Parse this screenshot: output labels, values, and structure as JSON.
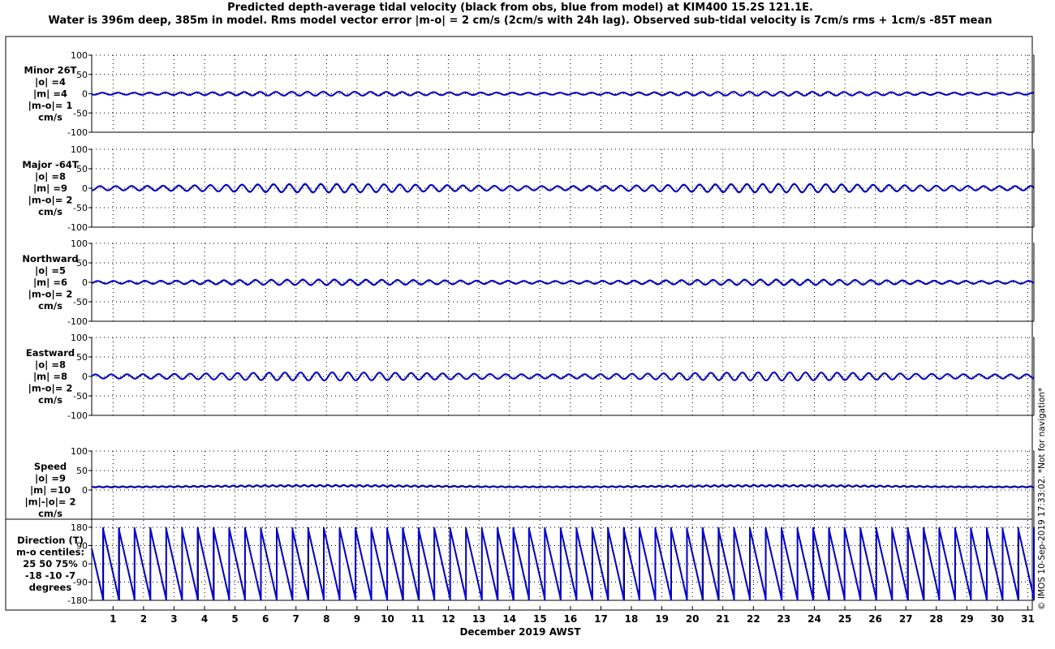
{
  "title_line1": "Predicted depth-average tidal velocity (black from obs, blue from model) at KIM400 15.2S 121.1E.",
  "title_line2": "Water is 396m deep, 385m in model. Rms model vector error |m-o| = 2 cm/s (2cm/s with 24h lag). Observed sub-tidal velocity is 7cm/s rms + 1cm/s -85T mean",
  "side_note": "© IMOS 10-Sep-2019 17:33:02. *Not for navigation*",
  "xlabel": "December 2019 AWST",
  "colors": {
    "obs": "#000000",
    "model": "#0000ff",
    "grid": "#000000"
  },
  "chart_data": {
    "type": "line",
    "x_ticks": [
      "1",
      "2",
      "3",
      "4",
      "5",
      "6",
      "7",
      "8",
      "9",
      "10",
      "11",
      "12",
      "13",
      "14",
      "15",
      "16",
      "17",
      "18",
      "19",
      "20",
      "21",
      "22",
      "23",
      "24",
      "25",
      "26",
      "27",
      "28",
      "29",
      "30",
      "31"
    ],
    "xlim": [
      0.3,
      31.2
    ],
    "grid": true,
    "panels": [
      {
        "key": "minor",
        "label_lines": [
          "Minor 26T",
          "|o| =4",
          "|m| =4",
          "|m-o|= 1",
          "cm/s"
        ],
        "ylim": [
          -100,
          100
        ],
        "yticks": [
          "100",
          "50",
          "0",
          "-50",
          "-100"
        ],
        "series": [
          {
            "name": "obs",
            "amplitude": 4,
            "mean": 0
          },
          {
            "name": "model",
            "amplitude": 4,
            "mean": 0
          }
        ]
      },
      {
        "key": "major",
        "label_lines": [
          "Major -64T",
          "|o| =8",
          "|m| =9",
          "|m-o|= 2",
          "cm/s"
        ],
        "ylim": [
          -100,
          100
        ],
        "yticks": [
          "100",
          "50",
          "0",
          "-50",
          "-100"
        ],
        "series": [
          {
            "name": "obs",
            "amplitude": 8,
            "mean": 0
          },
          {
            "name": "model",
            "amplitude": 9,
            "mean": 0
          }
        ]
      },
      {
        "key": "northward",
        "label_lines": [
          "Northward",
          "|o| =5",
          "|m| =6",
          "|m-o|= 2",
          "cm/s"
        ],
        "ylim": [
          -100,
          100
        ],
        "yticks": [
          "100",
          "50",
          "0",
          "-50",
          "-100"
        ],
        "series": [
          {
            "name": "obs",
            "amplitude": 5,
            "mean": 0
          },
          {
            "name": "model",
            "amplitude": 6,
            "mean": 0
          }
        ]
      },
      {
        "key": "eastward",
        "label_lines": [
          "Eastward",
          "|o| =8",
          "|m| =8",
          "|m-o|= 2",
          "cm/s"
        ],
        "ylim": [
          -100,
          100
        ],
        "yticks": [
          "100",
          "50",
          "0",
          "-50",
          "-100"
        ],
        "series": [
          {
            "name": "obs",
            "amplitude": 8,
            "mean": 0
          },
          {
            "name": "model",
            "amplitude": 8,
            "mean": 0
          }
        ]
      },
      {
        "key": "speed",
        "label_lines": [
          "Speed",
          "|o| =9",
          "|m| =10",
          "|m|-|o|= 2",
          "cm/s"
        ],
        "ylim": [
          -100,
          100
        ],
        "yticks": [
          "100",
          "50",
          "0"
        ],
        "series": [
          {
            "name": "obs",
            "amplitude": 3,
            "mean": 9
          },
          {
            "name": "model",
            "amplitude": 3,
            "mean": 10
          }
        ]
      },
      {
        "key": "direction",
        "label_lines": [
          "Direction (T)",
          "m-o centiles:",
          "25  50  75%",
          "-18 -10   -7",
          "degrees"
        ],
        "ylim": [
          -180,
          180
        ],
        "yticks": [
          "180",
          "90",
          "0",
          "-90",
          "-180"
        ],
        "series": [
          {
            "name": "obs"
          },
          {
            "name": "model"
          }
        ]
      }
    ]
  }
}
